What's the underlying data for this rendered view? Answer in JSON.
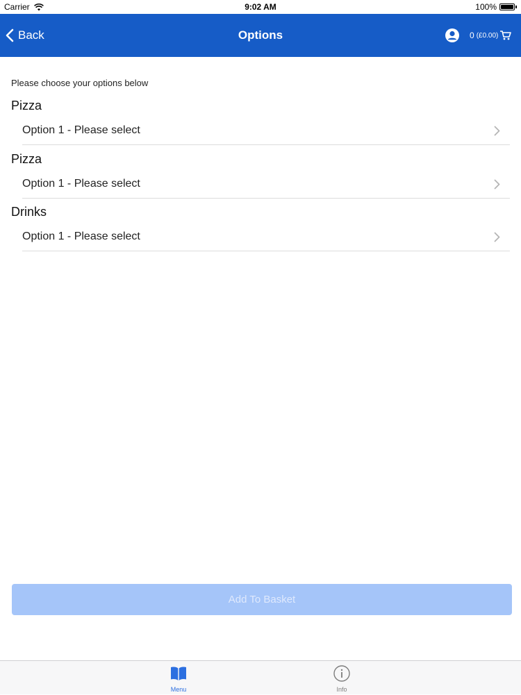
{
  "status_bar": {
    "carrier": "Carrier",
    "time": "9:02 AM",
    "battery": "100%"
  },
  "nav": {
    "back_label": "Back",
    "title": "Options",
    "basket_count": "0",
    "basket_total": "(£0.00)",
    "icons": [
      "chevron-left",
      "account-circle",
      "shopping-cart"
    ]
  },
  "intro": "Please choose your options below",
  "option_groups": [
    {
      "title": "Pizza",
      "option_label": "Option 1 - Please select"
    },
    {
      "title": "Pizza",
      "option_label": "Option 1 - Please select"
    },
    {
      "title": "Drinks",
      "option_label": "Option 1 - Please select"
    }
  ],
  "add_button_label": "Add To Basket",
  "tabs": [
    {
      "label": "Menu",
      "icon": "book-open",
      "active": true
    },
    {
      "label": "Info",
      "icon": "info-circle",
      "active": false
    }
  ],
  "colors": {
    "nav_background": "#165cc7",
    "add_button_disabled": "#a5c5f9",
    "tab_active": "#2c6fe0",
    "tab_inactive": "#7d7d7d"
  }
}
